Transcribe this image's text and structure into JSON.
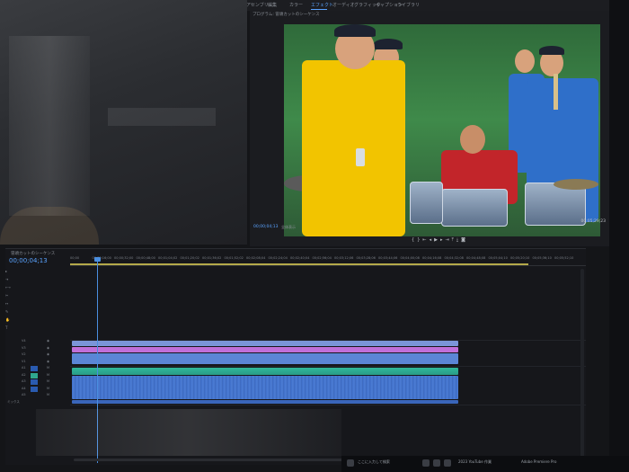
{
  "workspace_tabs": [
    "学習",
    "アセンブリ",
    "編集",
    "カラー",
    "エフェクト",
    "オーディオ",
    "グラフィック",
    "キャプション",
    "ライブラリ"
  ],
  "active_workspace_index": 4,
  "monitor": {
    "header": "プログラム: 冒頭カットのシーケンス",
    "timecode_left": "00;00;04;13",
    "timecode_right": "00;05;29;23",
    "fit_label": "全体表示"
  },
  "transport_icons": [
    "mark-in-icon",
    "mark-out-icon",
    "go-to-in-icon",
    "step-back-icon",
    "play-icon",
    "step-forward-icon",
    "go-to-out-icon",
    "lift-icon",
    "extract-icon",
    "export-frame-icon"
  ],
  "timeline": {
    "title": "冒頭カットのシーケンス",
    "timecode": "00;00;04;13",
    "ruler_ticks": [
      "00;00",
      "00;00;16;00",
      "00;00;32;00",
      "00;00;48;00",
      "00;01;04;02",
      "00;01;20;02",
      "00;01;36;02",
      "00;01;52;02",
      "00;02;08;04",
      "00;02;24;04",
      "00;02;40;04",
      "00;02;56;04",
      "00;03;12;06",
      "00;03;28;06",
      "00;03;44;06",
      "00;04;00;08",
      "00;04;16;08",
      "00;04;32;08",
      "00;04;48;08",
      "00;05;04;10",
      "00;05;20;10",
      "00;05;36;10",
      "00;05;52;10"
    ],
    "tracks": [
      {
        "label": "V4"
      },
      {
        "label": "V3"
      },
      {
        "label": "V2"
      },
      {
        "label": "V1"
      },
      {
        "label": "A1"
      },
      {
        "label": "A2"
      },
      {
        "label": "A3"
      },
      {
        "label": "A4"
      },
      {
        "label": "A5"
      }
    ],
    "mix_label": "ミックス"
  },
  "taskbar": {
    "search_placeholder": "ここに入力して検索",
    "items": [
      "2023 YouTube 作業",
      "Adobe Premiere Pro"
    ]
  },
  "colors": {
    "accent": "#5aa3ff",
    "clip_video": "#5b86d6",
    "clip_pink": "#c06fd8",
    "clip_audio": "#2fb89a"
  }
}
